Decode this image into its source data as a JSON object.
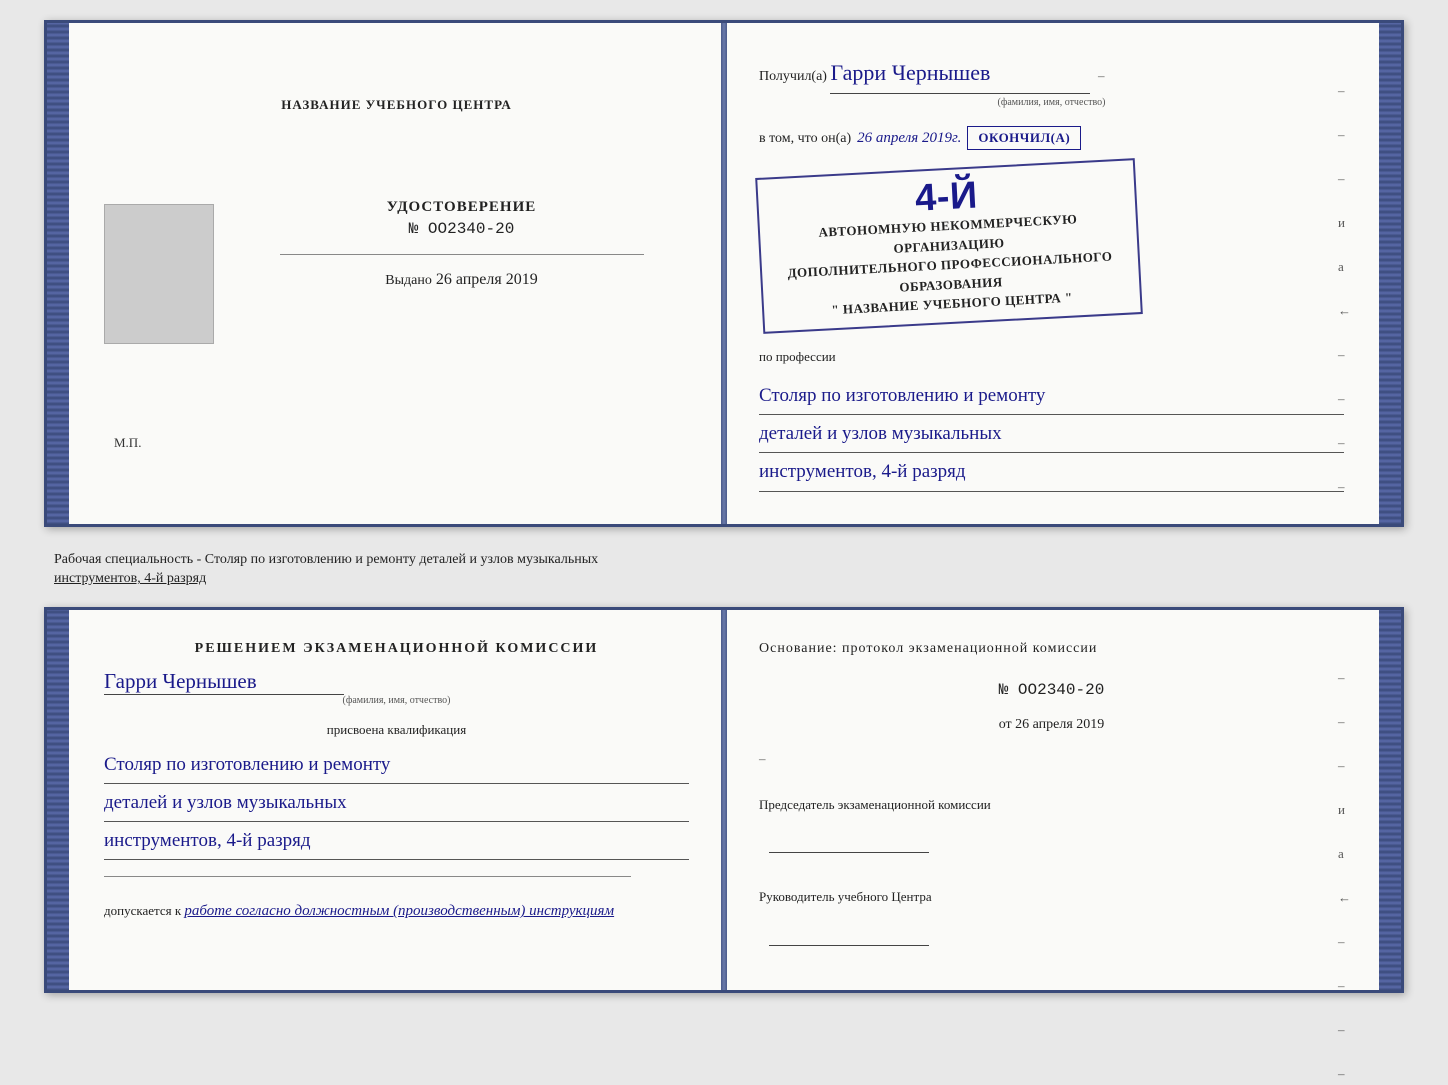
{
  "top_spread": {
    "left_page": {
      "org_name_label": "НАЗВАНИЕ УЧЕБНОГО ЦЕНТРА",
      "cert_title": "УДОСТОВЕРЕНИЕ",
      "cert_number": "№ OO2340-20",
      "issued_label": "Выдано",
      "issued_date": "26 апреля 2019",
      "mp_label": "М.П."
    },
    "right_page": {
      "poluchil_label": "Получил(а)",
      "recipient_name": "Гарри Чернышев",
      "fio_label": "(фамилия, имя, отчество)",
      "vtom_label": "в том, что он(а)",
      "vtom_date": "26 апреля 2019г.",
      "okonchil_label": "окончил(а)",
      "stamp_line1": "АВТОНОМНУЮ НЕКОММЕРЧЕСКУЮ ОРГАНИЗАЦИЮ",
      "stamp_line2": "ДОПОЛНИТЕЛЬНОГО ПРОФЕССИОНАЛЬНОГО ОБРАЗОВАНИЯ",
      "stamp_line3": "\" НАЗВАНИЕ УЧЕБНОГО ЦЕНТРА \"",
      "stamp_number": "4-й",
      "po_professii_label": "по профессии",
      "profession_line1": "Столяр по изготовлению и ремонту",
      "profession_line2": "деталей и узлов музыкальных",
      "profession_line3": "инструментов, 4-й разряд",
      "right_dashes": [
        "-",
        "-",
        "-",
        "и",
        "а",
        "←",
        "-",
        "-",
        "-",
        "-"
      ]
    }
  },
  "description": {
    "text": "Рабочая специальность - Столяр по изготовлению и ремонту деталей и узлов музыкальных инструментов, 4-й разряд"
  },
  "bottom_spread": {
    "left_page": {
      "decision_title": "Решением  экзаменационной  комиссии",
      "name_handwritten": "Гарри Чернышев",
      "fio_label": "(фамилия, имя, отчество)",
      "prisvoena_label": "присвоена квалификация",
      "profession_line1": "Столяр по изготовлению и ремонту",
      "profession_line2": "деталей и узлов музыкальных",
      "profession_line3": "инструментов, 4-й разряд",
      "dopuskaetsya_label": "допускается к",
      "dopusk_text": "работе согласно должностным (производственным) инструкциям"
    },
    "right_page": {
      "osnovanie_label": "Основание: протокол  экзаменационной  комиссии",
      "protocol_number": "№  OO2340-20",
      "ot_label": "от",
      "ot_date": "26 апреля 2019",
      "chairman_label": "Председатель экзаменационной комиссии",
      "rukvoditel_label": "Руководитель учебного Центра",
      "right_dashes": [
        "-",
        "-",
        "-",
        "и",
        "а",
        "←",
        "-",
        "-",
        "-",
        "-"
      ]
    }
  }
}
